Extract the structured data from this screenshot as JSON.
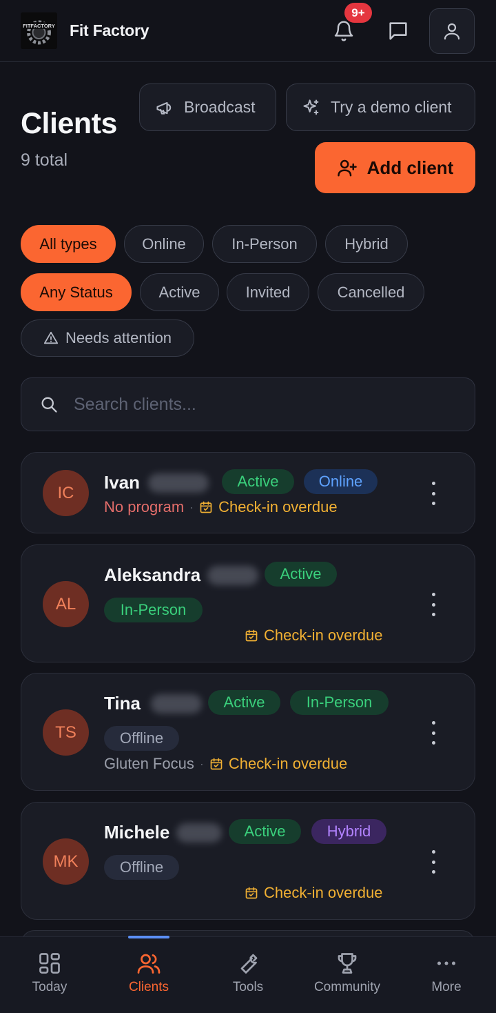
{
  "header": {
    "app_name": "Fit Factory",
    "logo_text": "FITFACTORY",
    "notification_badge": "9+"
  },
  "page": {
    "title": "Clients",
    "subtitle": "9 total"
  },
  "actions": {
    "broadcast": "Broadcast",
    "demo_client": "Try a demo client",
    "add_client": "Add client"
  },
  "filters": {
    "types": [
      "All types",
      "Online",
      "In-Person",
      "Hybrid"
    ],
    "selected_type": "All types",
    "statuses": [
      "Any Status",
      "Active",
      "Invited",
      "Cancelled"
    ],
    "selected_status": "Any Status",
    "attention": "Needs attention"
  },
  "search": {
    "placeholder": "Search clients..."
  },
  "clients": [
    {
      "initials": "IC",
      "name": "Ivan",
      "status": "Active",
      "type": "Online",
      "program": "No program",
      "checkin": "Check-in overdue"
    },
    {
      "initials": "AL",
      "name": "Aleksandra",
      "status": "Active",
      "type": "In-Person",
      "checkin": "Check-in overdue"
    },
    {
      "initials": "TS",
      "name": "Tina",
      "status": "Active",
      "type": "In-Person",
      "presence": "Offline",
      "program": "Gluten Focus",
      "checkin": "Check-in overdue"
    },
    {
      "initials": "MK",
      "name": "Michele",
      "status": "Active",
      "type": "Hybrid",
      "presence": "Offline",
      "checkin": "Check-in overdue"
    }
  ],
  "nav": {
    "items": [
      "Today",
      "Clients",
      "Tools",
      "Community",
      "More"
    ],
    "selected": "Clients"
  },
  "colors": {
    "accent": "#fb6631",
    "background": "#12131a",
    "card": "#1a1c25",
    "active_green": "#3ad07c",
    "online_blue": "#5ea2ff",
    "hybrid_purple": "#b283ff",
    "overdue_amber": "#f1b033",
    "no_program_red": "#e36d6a",
    "badge_red": "#e5363f"
  }
}
